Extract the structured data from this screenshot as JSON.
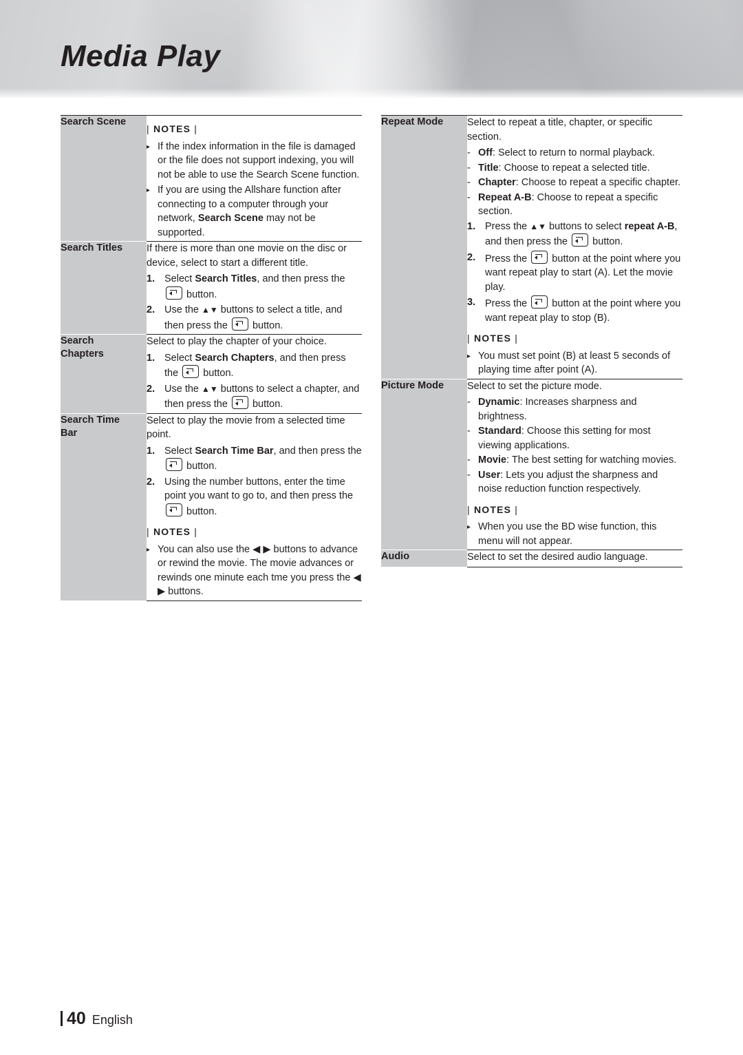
{
  "header": {
    "title": "Media Play"
  },
  "footer": {
    "page": "40",
    "language": "English"
  },
  "notes_label": "NOTES",
  "left_column": [
    {
      "label": "Search Scene",
      "notes_header": "NOTES",
      "notes": [
        "If the index information in the file is damaged or the file does not support indexing, you will not be able to use the Search Scene function.",
        "If you are using the Allshare function after connecting to a computer through your network, Search Scene may not be supported."
      ]
    },
    {
      "label": "Search Titles",
      "intro": "If there is more than one movie on the disc or device, select to start a different title.",
      "steps": [
        "Select Search Titles, and then press the ⏎ button.",
        "Use the ▲▼ buttons to select a title, and then press the ⏎ button."
      ]
    },
    {
      "label": "Search Chapters",
      "intro": "Select to play the chapter of your choice.",
      "steps": [
        "Select Search Chapters, and then press the ⏎ button.",
        "Use the ▲▼ buttons to select a chapter, and then press the ⏎ button."
      ]
    },
    {
      "label": "Search Time Bar",
      "intro": "Select to play the movie from a selected time point.",
      "steps": [
        "Select Search Time Bar, and then press the ⏎ button.",
        "Using the number buttons, enter the time point you want to go to, and then press the ⏎ button."
      ],
      "notes_header": "NOTES",
      "notes": [
        "You can also use the ◀ ▶ buttons to advance or rewind the movie. The movie advances or rewinds one minute each tme you press the ◀ ▶ buttons."
      ]
    }
  ],
  "right_column": [
    {
      "label": "Repeat Mode",
      "intro": "Select to repeat a title, chapter, or specific section.",
      "options": [
        {
          "term": "Off",
          "desc": ": Select to return to normal playback."
        },
        {
          "term": "Title",
          "desc": ": Choose to repeat a selected title."
        },
        {
          "term": "Chapter",
          "desc": ": Choose to repeat a specific chapter."
        },
        {
          "term": "Repeat A-B",
          "desc": ": Choose to repeat a specific section."
        }
      ],
      "steps": [
        "Press the ▲▼ buttons to select repeat A-B, and then press the ⏎ button.",
        "Press the ⏎ button at the point where you want repeat play to start (A). Let the movie play.",
        "Press the ⏎ button at the point where you want repeat play to stop (B)."
      ],
      "notes_header": "NOTES",
      "notes": [
        "You must set point (B) at least 5 seconds of playing time after point (A)."
      ]
    },
    {
      "label": "Picture Mode",
      "intro": "Select to set the picture mode.",
      "options": [
        {
          "term": "Dynamic",
          "desc": ": Increases sharpness and brightness."
        },
        {
          "term": "Standard",
          "desc": ": Choose this setting for most viewing applications."
        },
        {
          "term": "Movie",
          "desc": ": The best setting for watching movies."
        },
        {
          "term": "User",
          "desc": ": Lets you adjust the sharpness and noise reduction function respectively."
        }
      ],
      "notes_header": "NOTES",
      "notes": [
        "When you use the BD wise function, this menu will not appear."
      ]
    },
    {
      "label": "Audio",
      "intro": "Select to set the desired audio language."
    }
  ]
}
